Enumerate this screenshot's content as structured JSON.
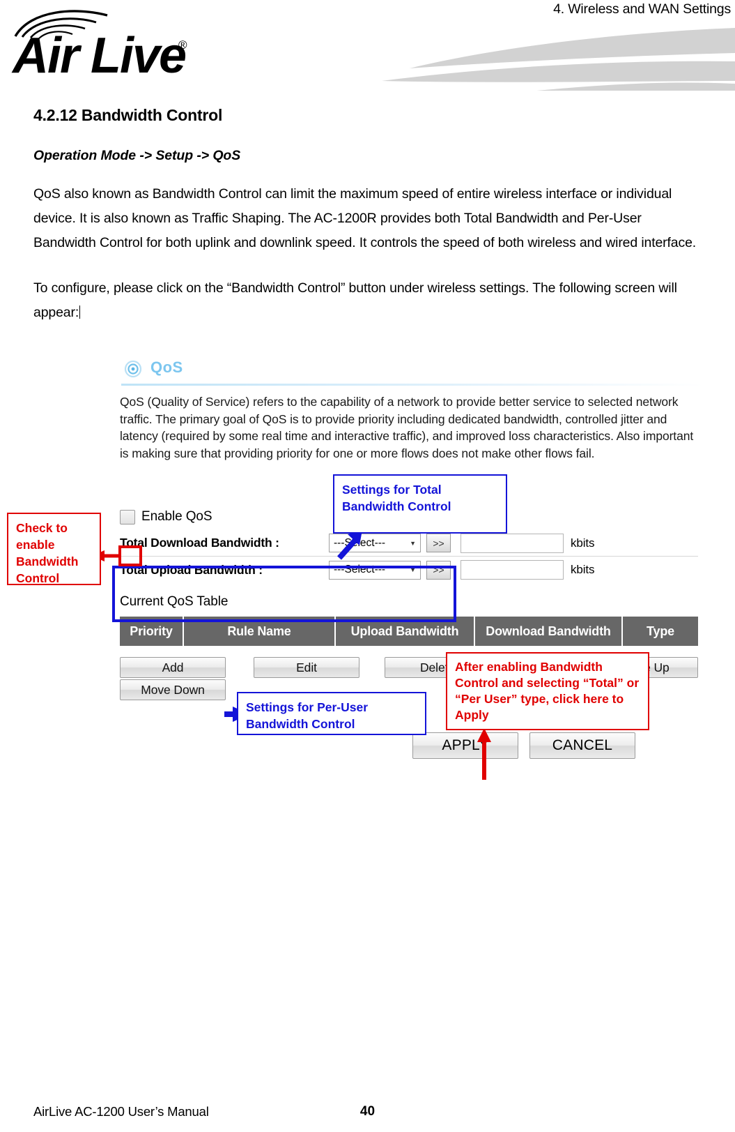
{
  "header": {
    "running_head": "4. Wireless and WAN Settings",
    "logo_text": "AirLive",
    "logo_mark": "wifi-waves-icon",
    "registered_mark": "®"
  },
  "document": {
    "section_number_title": "4.2.12 Bandwidth Control",
    "breadcrumb": "Operation Mode -> Setup -> QoS",
    "paragraph_1": "QoS also known as Bandwidth Control can limit the maximum speed of entire wireless interface or individual device. It is also known as Traffic Shaping. The AC-1200R provides both Total Bandwidth and Per-User Bandwidth Control for both uplink and downlink speed. It controls the speed of both wireless and wired interface.",
    "paragraph_2": "To configure, please click on the “Bandwidth Control” button under wireless settings. The following screen will appear:"
  },
  "screenshot": {
    "panel_title": "QoS",
    "panel_icon": "target-ring-icon",
    "description": "QoS (Quality of Service) refers to the capability of a network to provide better service to selected network traffic. The primary goal of QoS is to provide priority including dedicated bandwidth, controlled jitter and latency (required by some real time and interactive traffic), and improved loss characteristics. Also important is making sure that providing priority for one or more flows does not make other flows fail.",
    "enable_checkbox_label": "Enable QoS",
    "enable_checkbox_checked": false,
    "bandwidth_rows": [
      {
        "label": "Total Download Bandwidth :",
        "select_value": "---Select---",
        "go_button": ">>",
        "input_value": "",
        "unit": "kbits"
      },
      {
        "label": "Total Upload Bandwidth :",
        "select_value": "---Select---",
        "go_button": ">>",
        "input_value": "",
        "unit": "kbits"
      }
    ],
    "table_caption": "Current QoS Table",
    "table_headers": [
      "Priority",
      "Rule Name",
      "Upload Bandwidth",
      "Download Bandwidth",
      "Type"
    ],
    "buttons": {
      "add": "Add",
      "move_down": "Move Down",
      "edit": "Edit",
      "delete": "Delete",
      "move_up": "Move Up"
    },
    "footer_buttons": {
      "apply": "APPLY",
      "cancel": "CANCEL"
    }
  },
  "callouts": [
    {
      "id": "check-to-enable",
      "text": "Check to enable Bandwidth Control",
      "color": "#e00000"
    },
    {
      "id": "settings-total",
      "text": "Settings for Total Bandwidth Control",
      "color": "#1414d8"
    },
    {
      "id": "settings-per-user",
      "text": "Settings for Per-User Bandwidth Control",
      "color": "#1414d8"
    },
    {
      "id": "apply-note",
      "text": "After enabling Bandwidth Control and selecting “Total” or “Per User” type, click here to Apply",
      "color": "#e00000"
    }
  ],
  "footer": {
    "manual_name": "AirLive AC-1200 User’s Manual",
    "page_number": "40"
  }
}
